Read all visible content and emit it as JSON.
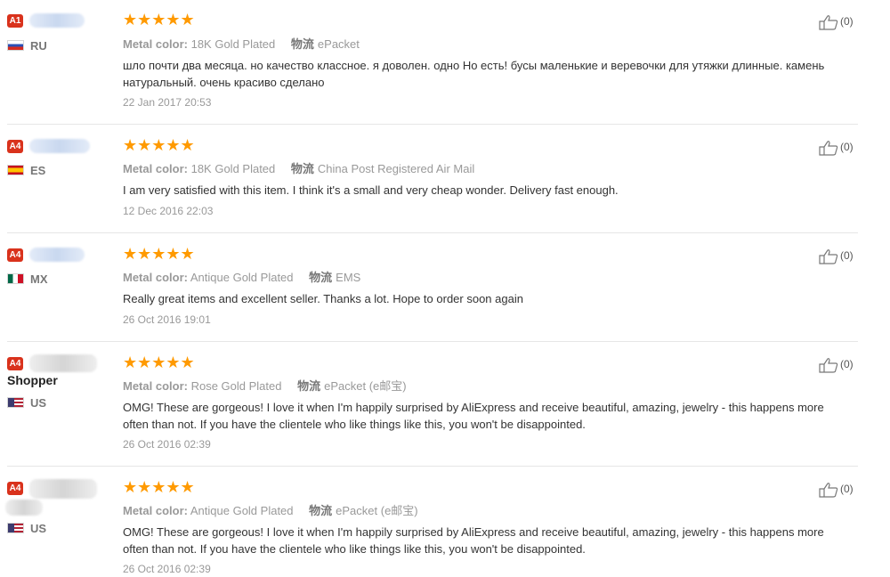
{
  "reviews": [
    {
      "level": "A1",
      "country": "RU",
      "buyer": "",
      "stars": "★★★★★",
      "color_label": "Metal color:",
      "color_value": "18K Gold Plated",
      "shipping_label": "物流",
      "shipping_value": "ePacket",
      "text": "шло почти два месяца. но качество классное. я доволен. одно Но есть! бусы маленькие и веревочки для утяжки длинные. камень натуральный. очень красиво сделано",
      "date": "22 Jan 2017 20:53",
      "helpful": "(0)"
    },
    {
      "level": "A4",
      "country": "ES",
      "buyer": "",
      "stars": "★★★★★",
      "color_label": "Metal color:",
      "color_value": "18K Gold Plated",
      "shipping_label": "物流",
      "shipping_value": "China Post Registered Air Mail",
      "text": "I am very satisfied with this item. I think it's a small and very cheap wonder. Delivery fast enough.",
      "date": "12 Dec 2016 22:03",
      "helpful": "(0)"
    },
    {
      "level": "A4",
      "country": "MX",
      "buyer": "",
      "stars": "★★★★★",
      "color_label": "Metal color:",
      "color_value": "Antique Gold Plated",
      "shipping_label": "物流",
      "shipping_value": "EMS",
      "text": "Really great items and excellent seller. Thanks a lot. Hope to order soon again",
      "date": "26 Oct 2016 19:01",
      "helpful": "(0)"
    },
    {
      "level": "A4",
      "country": "US",
      "buyer": "Shopper",
      "stars": "★★★★★",
      "color_label": "Metal color:",
      "color_value": "Rose Gold Plated",
      "shipping_label": "物流",
      "shipping_value": "ePacket (e邮宝)",
      "text": "OMG! These are gorgeous! I love it when I'm happily surprised by AliExpress and receive beautiful, amazing, jewelry - this happens more often than not. If you have the clientele who like things like this, you won't be disappointed.",
      "date": "26 Oct 2016 02:39",
      "helpful": "(0)"
    },
    {
      "level": "A4",
      "country": "US",
      "buyer": "",
      "stars": "★★★★★",
      "color_label": "Metal color:",
      "color_value": "Antique Gold Plated",
      "shipping_label": "物流",
      "shipping_value": "ePacket (e邮宝)",
      "text": "OMG! These are gorgeous! I love it when I'm happily surprised by AliExpress and receive beautiful, amazing, jewelry - this happens more often than not. If you have the clientele who like things like this, you won't be disappointed.",
      "date": "26 Oct 2016 02:39",
      "helpful": "(0)"
    }
  ],
  "colors": {
    "star": "#ff9a00",
    "badge": "#d9321c",
    "muted": "#999999"
  }
}
